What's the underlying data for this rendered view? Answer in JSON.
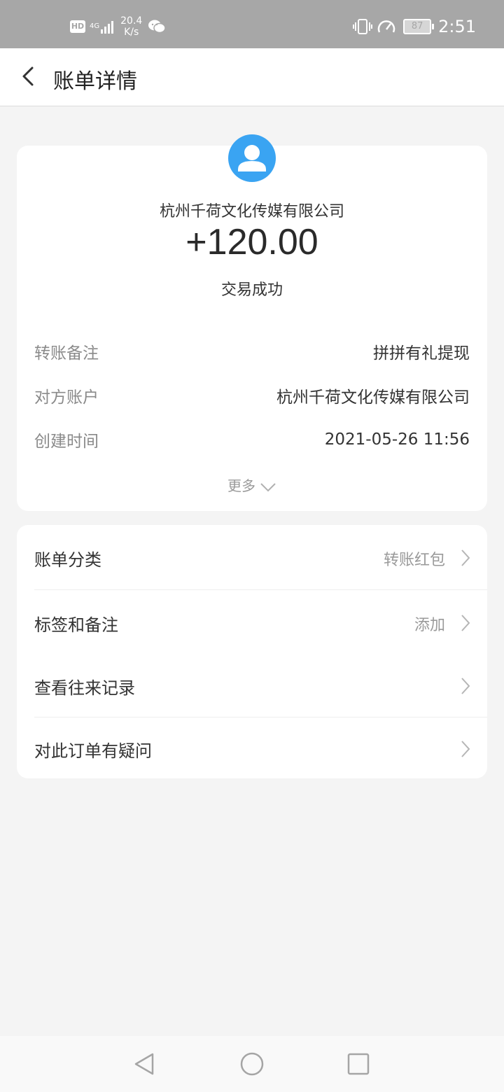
{
  "status_bar": {
    "network_badge": "HD",
    "network_type": "4G",
    "speed_value": "20.4",
    "speed_unit": "K/s",
    "battery": "87",
    "time": "2:51"
  },
  "header": {
    "title": "账单详情"
  },
  "transaction": {
    "merchant": "杭州千荷文化传媒有限公司",
    "amount": "+120.00",
    "status": "交易成功",
    "details": [
      {
        "label": "转账备注",
        "value": "拼拼有礼提现"
      },
      {
        "label": "对方账户",
        "value": "杭州千荷文化传媒有限公司"
      },
      {
        "label": "创建时间",
        "value": "2021-05-26 11:56"
      }
    ],
    "more_label": "更多"
  },
  "menu": {
    "items": [
      {
        "label": "账单分类",
        "value": "转账红包"
      },
      {
        "label": "标签和备注",
        "value": "添加"
      },
      {
        "label": "查看往来记录",
        "value": ""
      },
      {
        "label": "对此订单有疑问",
        "value": ""
      }
    ]
  },
  "colors": {
    "avatar": "#3aa4f2",
    "background": "#f4f4f4",
    "status_bar": "#a7a7a7"
  }
}
